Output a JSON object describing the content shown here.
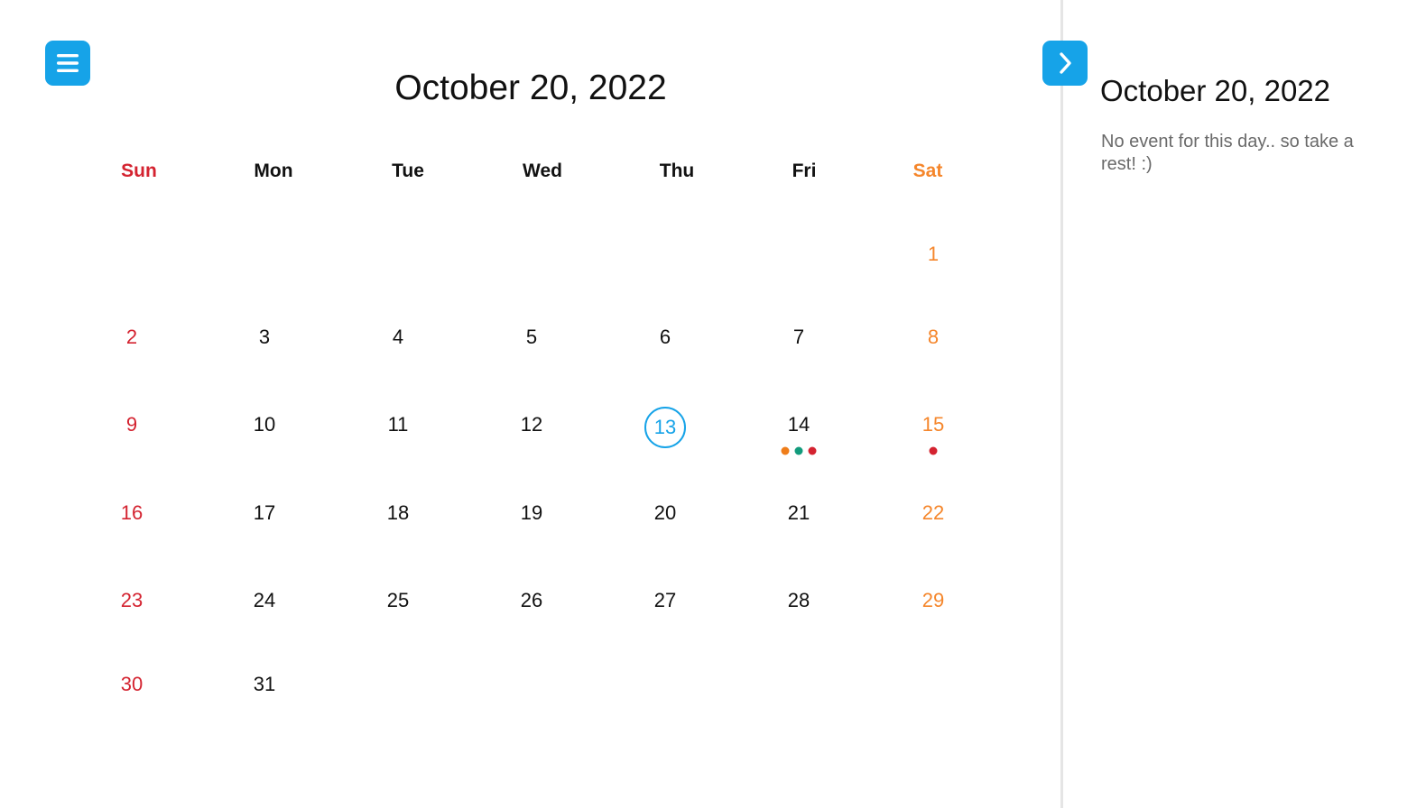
{
  "calendar": {
    "title": "October 20, 2022",
    "weekdays": [
      {
        "label": "Sun",
        "color": "#d42330"
      },
      {
        "label": "Mon",
        "color": "#111111"
      },
      {
        "label": "Tue",
        "color": "#111111"
      },
      {
        "label": "Wed",
        "color": "#111111"
      },
      {
        "label": "Thu",
        "color": "#111111"
      },
      {
        "label": "Fri",
        "color": "#111111"
      },
      {
        "label": "Sat",
        "color": "#f5862b"
      }
    ],
    "first_weekday_index": 6,
    "days_in_month": 31,
    "selected_day": 13,
    "event_dots": {
      "14": [
        "#ef7d1a",
        "#129b7c",
        "#d42330"
      ],
      "15": [
        "#d42330"
      ]
    }
  },
  "sidebar": {
    "title": "October 20, 2022",
    "message": "No event for this day.. so take a rest! :)"
  },
  "icons": {
    "menu": "hamburger-icon",
    "next": "chevron-right-icon"
  },
  "colors": {
    "accent": "#16a3e8",
    "sunday": "#d42330",
    "saturday": "#f5862b",
    "divider": "#e5e5e5"
  }
}
